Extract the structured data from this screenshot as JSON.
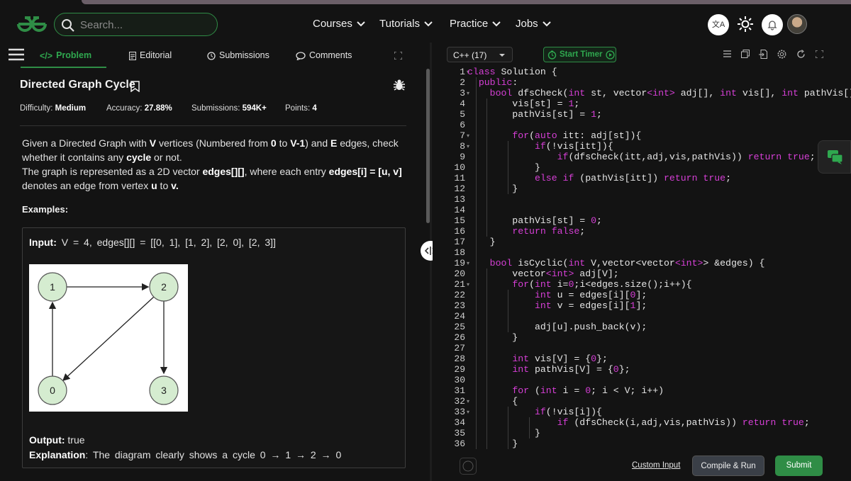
{
  "header": {
    "search_placeholder": "Search...",
    "nav": [
      "Courses",
      "Tutorials",
      "Practice",
      "Jobs"
    ],
    "lang_badge": "文A"
  },
  "tabs": {
    "problem": "Problem",
    "editorial": "Editorial",
    "submissions": "Submissions",
    "comments": "Comments"
  },
  "problem": {
    "title": "Directed Graph Cycle",
    "difficulty_label": "Difficulty:",
    "difficulty": "Medium",
    "accuracy_label": "Accuracy:",
    "accuracy": "27.88%",
    "submissions_label": "Submissions:",
    "submissions": "594K+",
    "points_label": "Points:",
    "points": "4",
    "desc1": "Given a Directed Graph with ",
    "V": "V",
    "desc2": " vertices (Numbered from ",
    "zero": "0",
    "desc3": " to ",
    "vminus": "V-1",
    "desc4": ") and ",
    "E": "E",
    "desc5": " edges, check whether it contains any ",
    "cycle": "cycle",
    "desc6": " or not.",
    "desc7": "The graph is represented as a 2D vector ",
    "edges_name": "edges[][]",
    "desc8": ", where each entry ",
    "edges_entry": "edges[i] = [u, v]",
    "desc9": " denotes an edge from vertex ",
    "u": "u",
    "desc10": " to ",
    "v": "v.",
    "examples_label": "Examples:",
    "input_label": "Input:",
    "input_value": "V = 4, edges[][] = [[0, 1], [1, 2], [2, 0], [2, 3]]",
    "output_label": "Output:",
    "output_value": "true",
    "explanation_label": "Explanation",
    "explanation_value": ": The diagram clearly shows a cycle 0 → 1 → 2 → 0",
    "graph_nodes": [
      "1",
      "2",
      "0",
      "3"
    ]
  },
  "editor": {
    "language": "C++ (17)",
    "timer": "Start Timer",
    "line_numbers": [
      "1",
      "2",
      "3",
      "4",
      "5",
      "6",
      "7",
      "8",
      "9",
      "10",
      "11",
      "12",
      "13",
      "14",
      "15",
      "16",
      "17",
      "18",
      "19",
      "20",
      "21",
      "22",
      "23",
      "24",
      "25",
      "26",
      "27",
      "28",
      "29",
      "30",
      "31",
      "32",
      "33",
      "34",
      "35",
      "36"
    ]
  },
  "footer": {
    "custom_input": "Custom Input",
    "compile_run": "Compile & Run",
    "submit": "Submit"
  },
  "colors": {
    "accent": "#2f8d46",
    "keyword": "#d63fd6",
    "node_fill": "#d5ecd0"
  }
}
